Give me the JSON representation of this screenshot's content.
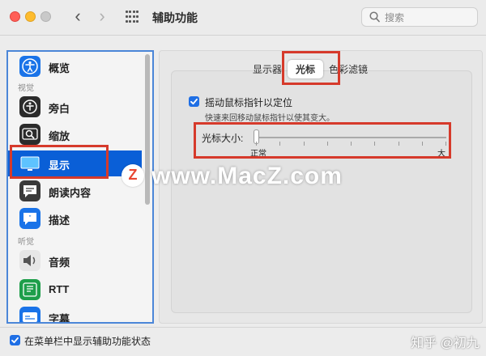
{
  "window": {
    "title": "辅助功能"
  },
  "search": {
    "placeholder": "搜索"
  },
  "sidebar": {
    "items": [
      {
        "label": "概览"
      },
      {
        "label": "旁白"
      },
      {
        "label": "缩放"
      },
      {
        "label": "显示"
      },
      {
        "label": "朗读内容"
      },
      {
        "label": "描述"
      },
      {
        "label": "音频"
      },
      {
        "label": "RTT"
      },
      {
        "label": "字幕"
      }
    ],
    "sections": {
      "vision": "视觉",
      "hearing": "听觉"
    },
    "selected": "显示"
  },
  "tabs": [
    {
      "label": "显示器"
    },
    {
      "label": "光标"
    },
    {
      "label": "色彩滤镜"
    }
  ],
  "selected_tab": "光标",
  "cursor_panel": {
    "shake_checkbox_label": "摇动鼠标指针以定位",
    "shake_checkbox_checked": true,
    "shake_help": "快速来回移动鼠标指针以使其变大。",
    "size_label": "光标大小:",
    "size_min_label": "正常",
    "size_max_label": "大",
    "size_value": 0
  },
  "footer": {
    "show_in_menubar_label": "在菜单栏中显示辅助功能状态",
    "show_in_menubar_checked": true
  },
  "watermarks": {
    "site": "www.MacZ.com",
    "logo_letter": "Z",
    "zhihu": "知乎 @初九"
  },
  "colors": {
    "accent": "#0a5fd7",
    "highlight": "#d63a2b"
  }
}
